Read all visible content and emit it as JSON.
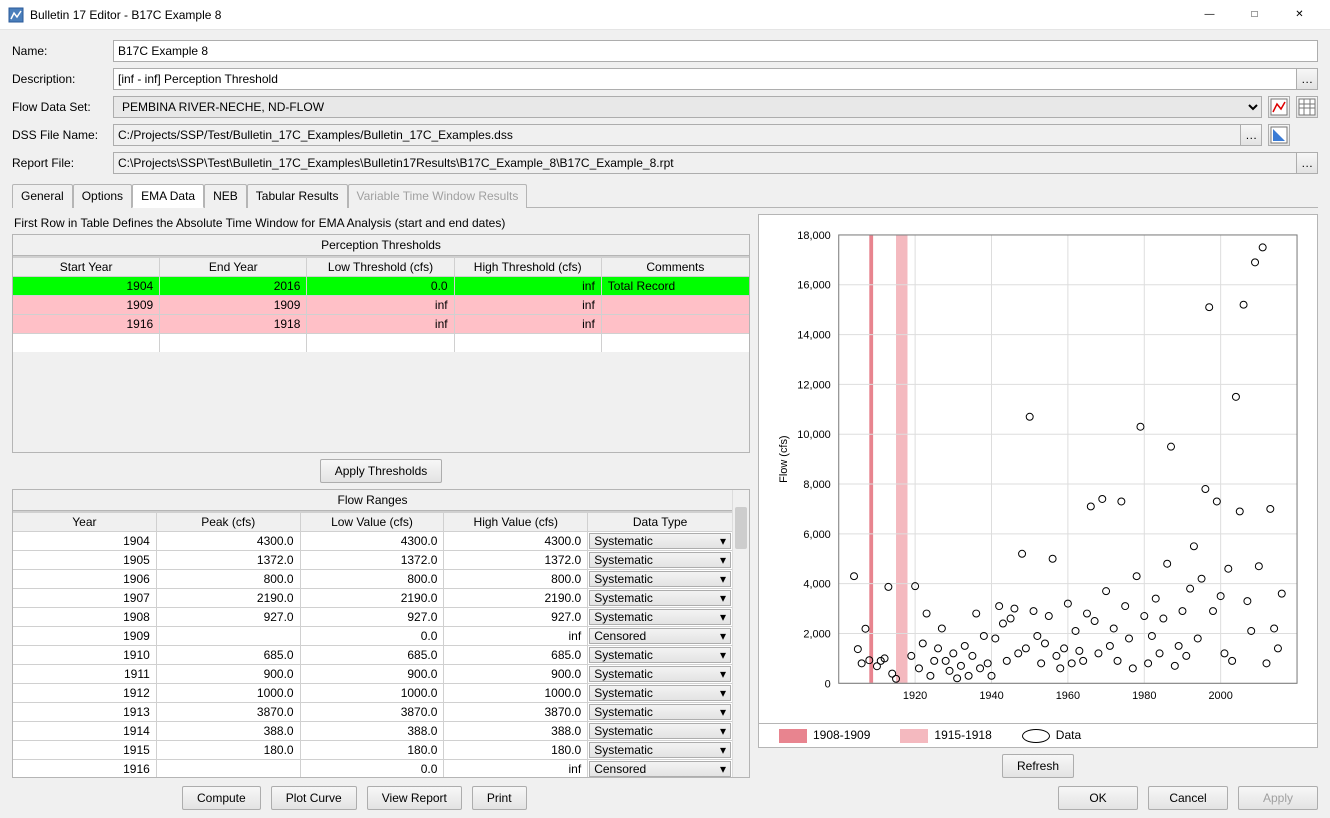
{
  "window": {
    "title": "Bulletin 17 Editor - B17C Example 8"
  },
  "form": {
    "name_label": "Name:",
    "name": "B17C Example 8",
    "desc_label": "Description:",
    "desc": "[inf - inf] Perception Threshold",
    "flowset_label": "Flow Data Set:",
    "flowset": "PEMBINA RIVER-NECHE, ND-FLOW",
    "dss_label": "DSS File Name:",
    "dss": "C:/Projects/SSP/Test/Bulletin_17C_Examples/Bulletin_17C_Examples.dss",
    "report_label": "Report File:",
    "report": "C:\\Projects\\SSP\\Test\\Bulletin_17C_Examples\\Bulletin17Results\\B17C_Example_8\\B17C_Example_8.rpt"
  },
  "tabs": {
    "general": "General",
    "options": "Options",
    "ema": "EMA Data",
    "neb": "NEB",
    "tabular": "Tabular Results",
    "vtw": "Variable Time Window Results"
  },
  "note": "First Row in Table Defines the Absolute Time Window for EMA Analysis (start and end dates)",
  "perc": {
    "title": "Perception Thresholds",
    "cols": {
      "start": "Start Year",
      "end": "End Year",
      "low": "Low Threshold (cfs)",
      "high": "High Threshold (cfs)",
      "cmt": "Comments"
    },
    "rows": [
      {
        "start": "1904",
        "end": "2016",
        "low": "0.0",
        "high": "inf",
        "cmt": "Total Record",
        "cls": "row-green"
      },
      {
        "start": "1909",
        "end": "1909",
        "low": "inf",
        "high": "inf",
        "cmt": "",
        "cls": "row-pink"
      },
      {
        "start": "1916",
        "end": "1918",
        "low": "inf",
        "high": "inf",
        "cmt": "",
        "cls": "row-pink"
      }
    ]
  },
  "apply_btn": "Apply Thresholds",
  "flow": {
    "title": "Flow Ranges",
    "cols": {
      "year": "Year",
      "peak": "Peak (cfs)",
      "low": "Low Value (cfs)",
      "high": "High Value (cfs)",
      "dt": "Data Type"
    },
    "rows": [
      {
        "year": "1904",
        "peak": "4300.0",
        "low": "4300.0",
        "high": "4300.0",
        "dt": "Systematic"
      },
      {
        "year": "1905",
        "peak": "1372.0",
        "low": "1372.0",
        "high": "1372.0",
        "dt": "Systematic"
      },
      {
        "year": "1906",
        "peak": "800.0",
        "low": "800.0",
        "high": "800.0",
        "dt": "Systematic"
      },
      {
        "year": "1907",
        "peak": "2190.0",
        "low": "2190.0",
        "high": "2190.0",
        "dt": "Systematic"
      },
      {
        "year": "1908",
        "peak": "927.0",
        "low": "927.0",
        "high": "927.0",
        "dt": "Systematic"
      },
      {
        "year": "1909",
        "peak": "",
        "low": "0.0",
        "high": "inf",
        "dt": "Censored"
      },
      {
        "year": "1910",
        "peak": "685.0",
        "low": "685.0",
        "high": "685.0",
        "dt": "Systematic"
      },
      {
        "year": "1911",
        "peak": "900.0",
        "low": "900.0",
        "high": "900.0",
        "dt": "Systematic"
      },
      {
        "year": "1912",
        "peak": "1000.0",
        "low": "1000.0",
        "high": "1000.0",
        "dt": "Systematic"
      },
      {
        "year": "1913",
        "peak": "3870.0",
        "low": "3870.0",
        "high": "3870.0",
        "dt": "Systematic"
      },
      {
        "year": "1914",
        "peak": "388.0",
        "low": "388.0",
        "high": "388.0",
        "dt": "Systematic"
      },
      {
        "year": "1915",
        "peak": "180.0",
        "low": "180.0",
        "high": "180.0",
        "dt": "Systematic"
      },
      {
        "year": "1916",
        "peak": "",
        "low": "0.0",
        "high": "inf",
        "dt": "Censored"
      }
    ]
  },
  "footer_btns": {
    "compute": "Compute",
    "plot": "Plot Curve",
    "view": "View Report",
    "print": "Print",
    "ok": "OK",
    "cancel": "Cancel",
    "apply": "Apply",
    "refresh": "Refresh"
  },
  "legend": {
    "a": "1908-1909",
    "b": "1915-1918",
    "c": "Data"
  },
  "chart_data": {
    "type": "scatter",
    "xlabel": "",
    "ylabel": "Flow (cfs)",
    "xlim": [
      1900,
      2020
    ],
    "ylim": [
      0,
      18000
    ],
    "xticks": [
      1920,
      1940,
      1960,
      1980,
      2000
    ],
    "yticks": [
      0,
      2000,
      4000,
      6000,
      8000,
      10000,
      12000,
      14000,
      16000,
      18000
    ],
    "bands": [
      {
        "from": 1908,
        "to": 1909,
        "color": "#e8848f"
      },
      {
        "from": 1915,
        "to": 1918,
        "color": "#f4b9bf"
      }
    ],
    "series": [
      {
        "name": "Data",
        "points": [
          [
            1904,
            4300
          ],
          [
            1905,
            1372
          ],
          [
            1906,
            800
          ],
          [
            1907,
            2190
          ],
          [
            1908,
            927
          ],
          [
            1910,
            685
          ],
          [
            1911,
            900
          ],
          [
            1912,
            1000
          ],
          [
            1913,
            3870
          ],
          [
            1914,
            388
          ],
          [
            1915,
            180
          ],
          [
            1919,
            1100
          ],
          [
            1920,
            3900
          ],
          [
            1921,
            600
          ],
          [
            1922,
            1600
          ],
          [
            1923,
            2800
          ],
          [
            1924,
            300
          ],
          [
            1925,
            900
          ],
          [
            1926,
            1400
          ],
          [
            1927,
            2200
          ],
          [
            1928,
            900
          ],
          [
            1929,
            500
          ],
          [
            1930,
            1200
          ],
          [
            1931,
            200
          ],
          [
            1932,
            700
          ],
          [
            1933,
            1500
          ],
          [
            1934,
            300
          ],
          [
            1935,
            1100
          ],
          [
            1936,
            2800
          ],
          [
            1937,
            600
          ],
          [
            1938,
            1900
          ],
          [
            1939,
            800
          ],
          [
            1940,
            300
          ],
          [
            1941,
            1800
          ],
          [
            1942,
            3100
          ],
          [
            1943,
            2400
          ],
          [
            1944,
            900
          ],
          [
            1945,
            2600
          ],
          [
            1946,
            3000
          ],
          [
            1947,
            1200
          ],
          [
            1948,
            5200
          ],
          [
            1949,
            1400
          ],
          [
            1950,
            10700
          ],
          [
            1951,
            2900
          ],
          [
            1952,
            1900
          ],
          [
            1953,
            800
          ],
          [
            1954,
            1600
          ],
          [
            1955,
            2700
          ],
          [
            1956,
            5000
          ],
          [
            1957,
            1100
          ],
          [
            1958,
            600
          ],
          [
            1959,
            1400
          ],
          [
            1960,
            3200
          ],
          [
            1961,
            800
          ],
          [
            1962,
            2100
          ],
          [
            1963,
            1300
          ],
          [
            1964,
            900
          ],
          [
            1965,
            2800
          ],
          [
            1966,
            7100
          ],
          [
            1967,
            2500
          ],
          [
            1968,
            1200
          ],
          [
            1969,
            7400
          ],
          [
            1970,
            3700
          ],
          [
            1971,
            1500
          ],
          [
            1972,
            2200
          ],
          [
            1973,
            900
          ],
          [
            1974,
            7300
          ],
          [
            1975,
            3100
          ],
          [
            1976,
            1800
          ],
          [
            1977,
            600
          ],
          [
            1978,
            4300
          ],
          [
            1979,
            10300
          ],
          [
            1980,
            2700
          ],
          [
            1981,
            800
          ],
          [
            1982,
            1900
          ],
          [
            1983,
            3400
          ],
          [
            1984,
            1200
          ],
          [
            1985,
            2600
          ],
          [
            1986,
            4800
          ],
          [
            1987,
            9500
          ],
          [
            1988,
            700
          ],
          [
            1989,
            1500
          ],
          [
            1990,
            2900
          ],
          [
            1991,
            1100
          ],
          [
            1992,
            3800
          ],
          [
            1993,
            5500
          ],
          [
            1994,
            1800
          ],
          [
            1995,
            4200
          ],
          [
            1996,
            7800
          ],
          [
            1997,
            15100
          ],
          [
            1998,
            2900
          ],
          [
            1999,
            7300
          ],
          [
            2000,
            3500
          ],
          [
            2001,
            1200
          ],
          [
            2002,
            4600
          ],
          [
            2003,
            900
          ],
          [
            2004,
            11500
          ],
          [
            2005,
            6900
          ],
          [
            2006,
            15200
          ],
          [
            2007,
            3300
          ],
          [
            2008,
            2100
          ],
          [
            2009,
            16900
          ],
          [
            2010,
            4700
          ],
          [
            2011,
            17500
          ],
          [
            2012,
            800
          ],
          [
            2013,
            7000
          ],
          [
            2014,
            2200
          ],
          [
            2015,
            1400
          ],
          [
            2016,
            3600
          ]
        ]
      }
    ]
  }
}
